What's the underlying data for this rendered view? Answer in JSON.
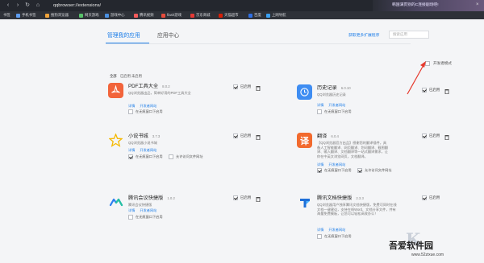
{
  "browser": {
    "url": "qqbrowser://extensions/",
    "ad_text": "韩国满贯别的C连接剧场吧!",
    "bookmarks": [
      "书签",
      "手机书签",
      "搜狗浏览器",
      "网页游戏",
      "游戏中心",
      "腾讯视频",
      "flash游戏",
      "京东商城",
      "天猫超市",
      "百度",
      "上网导航"
    ]
  },
  "header": {
    "tab_manage": "管理我的应用",
    "tab_center": "应用中心",
    "get_more": "获取更多扩展程序",
    "search_placeholder": "搜索应用"
  },
  "filters": [
    "全部",
    "已启用",
    "未启用"
  ],
  "dev_mode": {
    "label": "开发者模式",
    "checked": false
  },
  "extensions": [
    {
      "name": "PDF工具大全",
      "version": "8.0.2",
      "desc": "QQ浏览器出品，简单好用的PDF工具大全",
      "links": [
        "详情",
        "开发者网站"
      ],
      "incognito_label": "在无痕窗口下启用",
      "incognito": false,
      "enabled_label": "已启用",
      "enabled": true,
      "icon": "pdf-icon",
      "color": "#f2643b"
    },
    {
      "name": "历史记录",
      "version": "6.0.10",
      "desc": "QQ浏览器历史记录",
      "links": [
        "详情",
        "开发者网站"
      ],
      "incognito_label": "在无痕窗口下启用",
      "incognito": false,
      "enabled_label": "已启用",
      "enabled": true,
      "icon": "clock-icon",
      "color": "#3e8df2"
    },
    {
      "name": "小说书城",
      "version": "3.7.3",
      "desc": "QQ浏览器小说书城",
      "links": [
        "详情",
        "开发者网站"
      ],
      "incognito_label": "在无痕窗口下启用",
      "incognito": true,
      "file_label": "允许访问文件网址",
      "file_access": false,
      "enabled_label": "已启用",
      "enabled": true,
      "icon": "star-icon",
      "color": "#f5b800"
    },
    {
      "name": "翻译",
      "version": "6.0.4",
      "desc": "【QQ浏览器官方出品】感谢您的翻译插件，具备人工智能翻译、网页翻译、划词翻译、截图翻译、输入翻译、文档翻译等一站式翻译需求，让你在中英文浏览网页，文档翻译。",
      "links": [
        "详情",
        "开发者网站"
      ],
      "incognito_label": "在无痕窗口下启用",
      "incognito": true,
      "file_label": "允许访问文件网址",
      "file_access": true,
      "enabled_label": "已启用",
      "enabled": true,
      "icon": "translate-icon",
      "color": "#f26a2e"
    },
    {
      "name": "腾讯会议快捷版",
      "version": "1.0.2",
      "desc": "腾讯会议快捷版",
      "links": [
        "详情",
        "开发者网站"
      ],
      "incognito_label": "在无痕窗口下启用",
      "incognito": false,
      "enabled_label": "已启用",
      "enabled": true,
      "icon": "meeting-icon",
      "color": "#2c7ef0"
    },
    {
      "name": "腾讯文档快捷版",
      "version": "2.3.3",
      "desc": "QQ浏览器用户独享腾讯文档快捷版，免费可同时在线文档一键建议，支持在线Word、文档分享文件，并有海量免费模板，让您可以轻松高效办公！",
      "links": [
        "详情",
        "开发者网站"
      ],
      "incognito_label": "在无痕窗口下启用",
      "incognito": false,
      "enabled_label": "已启用",
      "enabled": true,
      "icon": "docs-icon",
      "color": "#1e6fd8"
    }
  ],
  "watermark": {
    "title": "吾爱软件园",
    "url": "www.52zixue.com"
  }
}
